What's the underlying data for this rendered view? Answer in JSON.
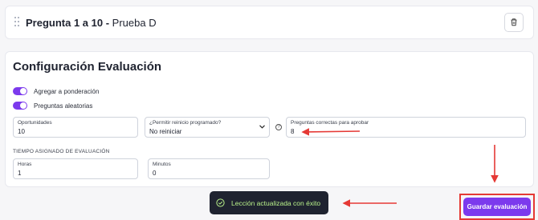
{
  "question": {
    "prefix": "Pregunta 1 a 10 - ",
    "name": "Prueba D"
  },
  "config": {
    "title": "Configuración Evaluación",
    "toggles": [
      {
        "label": "Agregar a ponderación",
        "on": true
      },
      {
        "label": "Preguntas aleatorias",
        "on": true
      }
    ],
    "fields": {
      "oportunidades": {
        "label": "Oportunidades",
        "value": "10"
      },
      "reinicio": {
        "label": "¿Permitir reinicio programado?",
        "value": "No reiniciar"
      },
      "correctas": {
        "label": "Preguntas correctas para aprobar",
        "value": "8"
      },
      "horas": {
        "label": "Horas",
        "value": "1"
      },
      "minutos": {
        "label": "Minutos",
        "value": "0"
      }
    },
    "time_section_label": "TIEMPO ASIGNADO DE EVALUACIÓN"
  },
  "toast": {
    "message": "Lección actualizada con éxito"
  },
  "save_button": {
    "label": "Guardar evaluación"
  },
  "colors": {
    "accent": "#7c3aed",
    "annotation": "#e53935",
    "toast_bg": "#1f2330",
    "toast_text": "#b9f28a"
  }
}
